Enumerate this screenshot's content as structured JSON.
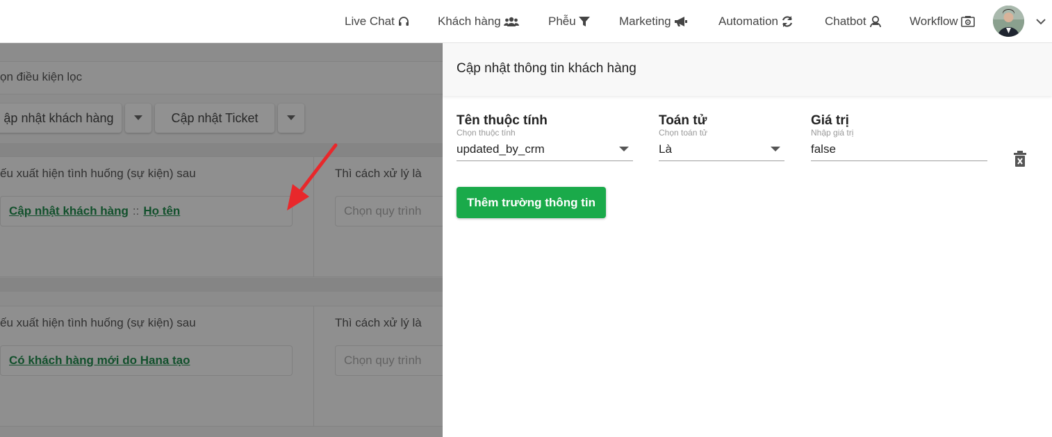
{
  "nav": {
    "items": [
      {
        "label": "Live Chat",
        "icon": "headset-icon"
      },
      {
        "label": "Khách hàng",
        "icon": "users-icon"
      },
      {
        "label": "Phễu",
        "icon": "filter-icon"
      },
      {
        "label": "Marketing",
        "icon": "megaphone-icon"
      },
      {
        "label": "Automation",
        "icon": "sync-icon"
      },
      {
        "label": "Chatbot",
        "icon": "bot-icon"
      },
      {
        "label": "Workflow",
        "icon": "workflow-icon"
      }
    ]
  },
  "background": {
    "filter_text": "ọn điều kiện lọc",
    "buttons": {
      "update_customer": "ập nhật khách hàng",
      "update_ticket": "Cập nhật Ticket"
    },
    "rules": [
      {
        "condition_label": "ếu xuất hiện tình huống (sự kiện) sau",
        "action_label": "Thì cách xử lý là",
        "event_main": "Cập nhật khách hàng",
        "event_sep": "::",
        "event_sub": "Họ tên",
        "flow_placeholder": "Chọn quy trình"
      },
      {
        "condition_label": "ếu xuất hiện tình huống (sự kiện) sau",
        "action_label": "Thì cách xử lý là",
        "event_main": "Có khách hàng mới do Hana tạo",
        "flow_placeholder": "Chọn quy trình"
      }
    ]
  },
  "panel": {
    "title": "Cập nhật thông tin khách hàng",
    "fields": {
      "attribute": {
        "label": "Tên thuộc tính",
        "hint": "Chọn thuộc tính",
        "value": "updated_by_crm"
      },
      "operator": {
        "label": "Toán tử",
        "hint": "Chọn toán tử",
        "value": "Là"
      },
      "value": {
        "label": "Giá trị",
        "hint": "Nhập giá trị",
        "value": "false"
      }
    },
    "add_button": "Thêm trường thông tin"
  },
  "colors": {
    "accent_green": "#1aaa4a",
    "link_green": "#1f8a4c",
    "annotation_arrow": "#e8282b"
  }
}
